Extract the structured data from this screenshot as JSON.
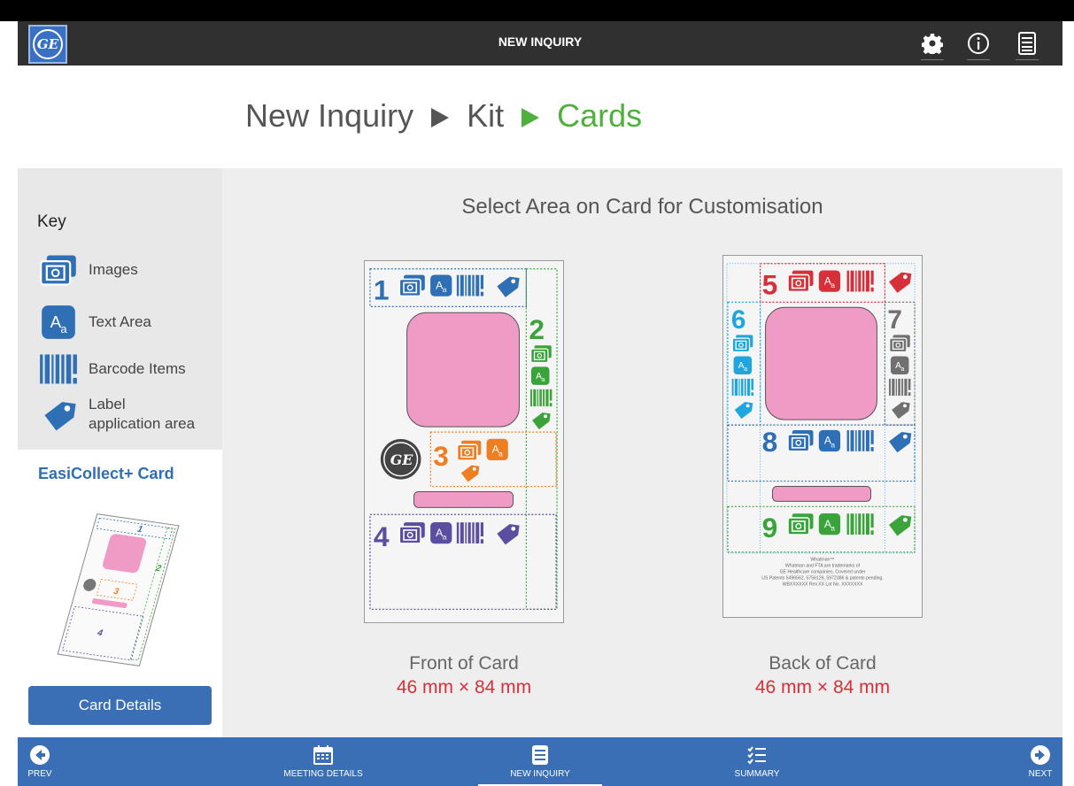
{
  "header": {
    "title": "NEW INQUIRY",
    "logo_text": "GE"
  },
  "breadcrumb": {
    "items": [
      "New Inquiry",
      "Kit",
      "Cards"
    ]
  },
  "key": {
    "title": "Key",
    "items": [
      {
        "icon": "image-icon",
        "label": "Images"
      },
      {
        "icon": "text-area-icon",
        "label": "Text Area"
      },
      {
        "icon": "barcode-icon",
        "label": "Barcode Items"
      },
      {
        "icon": "label-tag-icon",
        "label_line1": "Label",
        "label_line2": "application area"
      }
    ]
  },
  "card_panel": {
    "name": "EasiCollect+ Card",
    "thumb_numbers": [
      "1",
      "2",
      "3",
      "4"
    ],
    "details_button": "Card Details"
  },
  "main": {
    "title": "Select Area on Card for Customisation",
    "front": {
      "name": "Front of Card",
      "size": "46 mm × 84 mm",
      "areas": [
        "1",
        "2",
        "3",
        "4"
      ]
    },
    "back": {
      "name": "Back of Card",
      "size": "46 mm × 84 mm",
      "areas": [
        "5",
        "6",
        "7",
        "8",
        "9"
      ],
      "fine_print": [
        "Whatman™",
        "Whatman and FTA are trademarks of",
        "GE Healthcare companies. Covered under",
        "US Patents 5496562, 5756126, 5972386 & patents pending.",
        "WBXXXXXX  Rev.XX  Lot No. XXXXXXX"
      ]
    }
  },
  "footer": {
    "prev": "PREV",
    "meeting_details": "MEETING DETAILS",
    "new_inquiry": "NEW INQUIRY",
    "summary": "SUMMARY",
    "next": "NEXT"
  },
  "colors": {
    "area1": "#2f6fb5",
    "area2": "#3aa33a",
    "area3": "#ef7d22",
    "area4": "#5a4ea0",
    "area5": "#d7303a",
    "area6": "#20a6df",
    "area7": "#707070",
    "area8": "#2f6fb5",
    "area9": "#3aa33a",
    "pink": "#f09bc6",
    "brand_blue": "#3a6fb6",
    "breadcrumb_active": "#4fb13b",
    "dimension": "#d7303a"
  }
}
